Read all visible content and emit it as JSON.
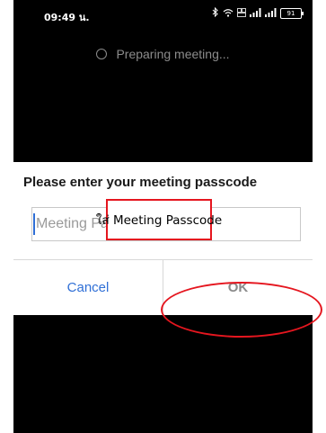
{
  "status_bar": {
    "time": "09:49 น.",
    "battery": "91"
  },
  "preparing_text": "Preparing meeting...",
  "dialog": {
    "title": "Please enter your meeting passcode",
    "input_placeholder": "Meeting Passcode",
    "cancel_label": "Cancel",
    "ok_label": "OK"
  },
  "annotation": {
    "label": "ใส่ Meeting Passcode",
    "color": "#e5161f"
  },
  "colors": {
    "screen_bg": "#000000",
    "dialog_bg": "#ffffff",
    "accent": "#2f6fd6"
  }
}
